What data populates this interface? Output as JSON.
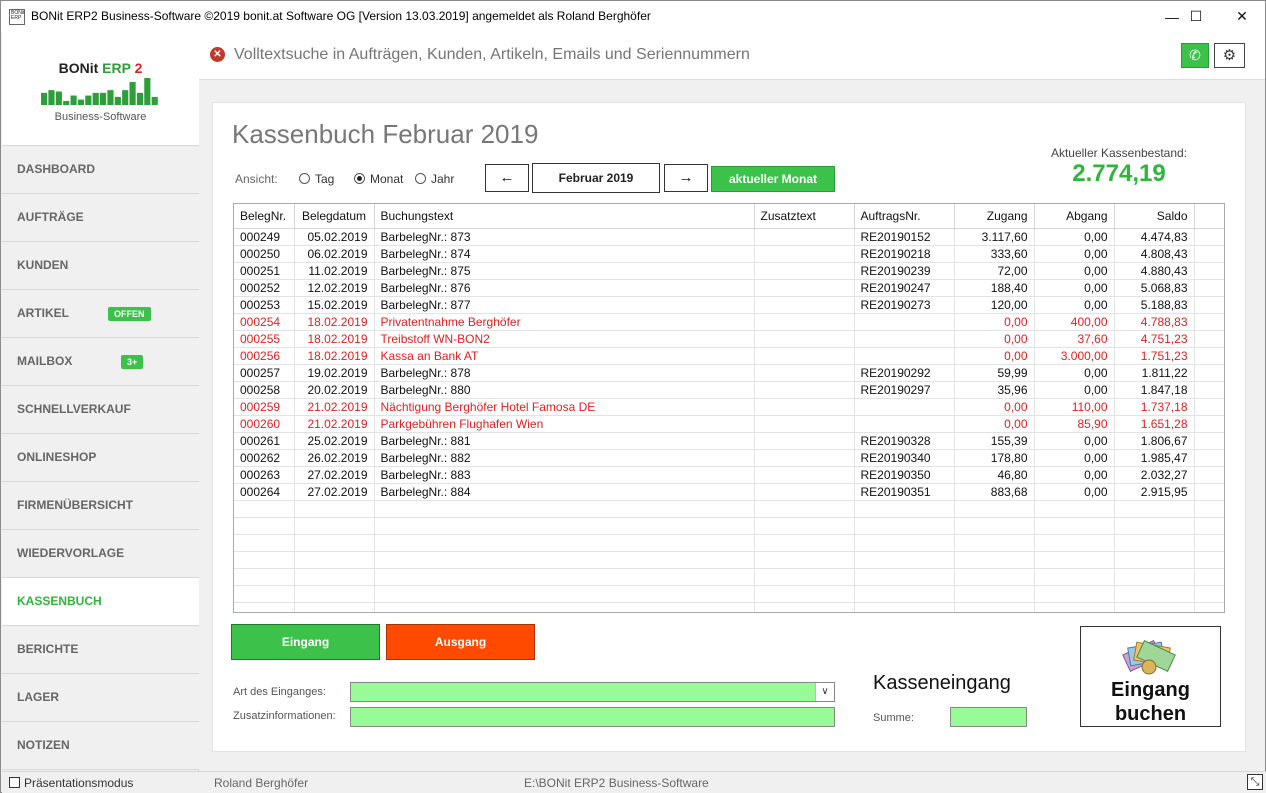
{
  "window": {
    "title": "BONit ERP2 Business-Software ©2019 bonit.at Software OG [Version 13.03.2019] angemeldet als Roland Berghöfer",
    "icon_text": "BONit ERP",
    "minimize": "—",
    "maximize": "☐",
    "close": "✕"
  },
  "logo": {
    "name_a": "BONit ",
    "name_b": "ERP",
    "name_c": " 2",
    "subtitle": "Business-Software",
    "bar_levels": [
      0.45,
      0.55,
      0.5,
      0.15,
      0.35,
      0.2,
      0.35,
      0.45,
      0.45,
      0.55,
      0.3,
      0.55,
      0.85,
      0.45,
      1.0,
      0.3
    ],
    "bar_color": "#2e9e3a"
  },
  "sidebar": {
    "items": [
      {
        "label": "DASHBOARD",
        "badge": ""
      },
      {
        "label": "AUFTRÄGE",
        "badge": ""
      },
      {
        "label": "KUNDEN",
        "badge": ""
      },
      {
        "label": "ARTIKEL",
        "badge": "OFFEN"
      },
      {
        "label": "MAILBOX",
        "badge": "3+"
      },
      {
        "label": "SCHNELLVERKAUF",
        "badge": ""
      },
      {
        "label": "ONLINESHOP",
        "badge": ""
      },
      {
        "label": "FIRMENÜBERSICHT",
        "badge": ""
      },
      {
        "label": "WIEDERVORLAGE",
        "badge": ""
      },
      {
        "label": "KASSENBUCH",
        "badge": "",
        "active": true
      },
      {
        "label": "BERICHTE",
        "badge": ""
      },
      {
        "label": "LAGER",
        "badge": ""
      },
      {
        "label": "NOTIZEN",
        "badge": ""
      }
    ]
  },
  "topbar": {
    "search_placeholder": "Volltextsuche in Aufträgen, Kunden, Artikeln, Emails und Seriennummern",
    "phone_icon": "✆",
    "gear_icon": "⚙"
  },
  "page": {
    "title": "Kassenbuch Februar 2019",
    "balance_label": "Aktueller Kassenbestand:",
    "balance_value": "2.774,19",
    "view_label": "Ansicht:",
    "view_options": [
      "Tag",
      "Monat",
      "Jahr"
    ],
    "view_selected": "Monat",
    "prev": "←",
    "next": "→",
    "month": "Februar 2019",
    "current_month_button": "aktueller Monat"
  },
  "table": {
    "columns": [
      "BelegNr.",
      "Belegdatum",
      "Buchungstext",
      "Zusatztext",
      "AuftragsNr.",
      "Zugang",
      "Abgang",
      "Saldo"
    ],
    "rows": [
      {
        "beleg": "000249",
        "datum": "05.02.2019",
        "text": "BarbelegNr.: 873",
        "zusatz": "",
        "auftrag": "RE20190152",
        "zugang": "3.117,60",
        "abgang": "0,00",
        "saldo": "4.474,83",
        "expense": false
      },
      {
        "beleg": "000250",
        "datum": "06.02.2019",
        "text": "BarbelegNr.: 874",
        "zusatz": "",
        "auftrag": "RE20190218",
        "zugang": "333,60",
        "abgang": "0,00",
        "saldo": "4.808,43",
        "expense": false
      },
      {
        "beleg": "000251",
        "datum": "11.02.2019",
        "text": "BarbelegNr.: 875",
        "zusatz": "",
        "auftrag": "RE20190239",
        "zugang": "72,00",
        "abgang": "0,00",
        "saldo": "4.880,43",
        "expense": false
      },
      {
        "beleg": "000252",
        "datum": "12.02.2019",
        "text": "BarbelegNr.: 876",
        "zusatz": "",
        "auftrag": "RE20190247",
        "zugang": "188,40",
        "abgang": "0,00",
        "saldo": "5.068,83",
        "expense": false
      },
      {
        "beleg": "000253",
        "datum": "15.02.2019",
        "text": "BarbelegNr.: 877",
        "zusatz": "",
        "auftrag": "RE20190273",
        "zugang": "120,00",
        "abgang": "0,00",
        "saldo": "5.188,83",
        "expense": false
      },
      {
        "beleg": "000254",
        "datum": "18.02.2019",
        "text": "Privatentnahme Berghöfer",
        "zusatz": "",
        "auftrag": "",
        "zugang": "0,00",
        "abgang": "400,00",
        "saldo": "4.788,83",
        "expense": true
      },
      {
        "beleg": "000255",
        "datum": "18.02.2019",
        "text": "Treibstoff WN-BON2",
        "zusatz": "",
        "auftrag": "",
        "zugang": "0,00",
        "abgang": "37,60",
        "saldo": "4.751,23",
        "expense": true
      },
      {
        "beleg": "000256",
        "datum": "18.02.2019",
        "text": "Kassa an Bank AT",
        "zusatz": "",
        "auftrag": "",
        "zugang": "0,00",
        "abgang": "3.000,00",
        "saldo": "1.751,23",
        "expense": true
      },
      {
        "beleg": "000257",
        "datum": "19.02.2019",
        "text": "BarbelegNr.: 878",
        "zusatz": "",
        "auftrag": "RE20190292",
        "zugang": "59,99",
        "abgang": "0,00",
        "saldo": "1.811,22",
        "expense": false
      },
      {
        "beleg": "000258",
        "datum": "20.02.2019",
        "text": "BarbelegNr.: 880",
        "zusatz": "",
        "auftrag": "RE20190297",
        "zugang": "35,96",
        "abgang": "0,00",
        "saldo": "1.847,18",
        "expense": false
      },
      {
        "beleg": "000259",
        "datum": "21.02.2019",
        "text": "Nächtigung Berghöfer Hotel Famosa DE",
        "zusatz": "",
        "auftrag": "",
        "zugang": "0,00",
        "abgang": "110,00",
        "saldo": "1.737,18",
        "expense": true
      },
      {
        "beleg": "000260",
        "datum": "21.02.2019",
        "text": "Parkgebühren Flughafen Wien",
        "zusatz": "",
        "auftrag": "",
        "zugang": "0,00",
        "abgang": "85,90",
        "saldo": "1.651,28",
        "expense": true
      },
      {
        "beleg": "000261",
        "datum": "25.02.2019",
        "text": "BarbelegNr.: 881",
        "zusatz": "",
        "auftrag": "RE20190328",
        "zugang": "155,39",
        "abgang": "0,00",
        "saldo": "1.806,67",
        "expense": false
      },
      {
        "beleg": "000262",
        "datum": "26.02.2019",
        "text": "BarbelegNr.: 882",
        "zusatz": "",
        "auftrag": "RE20190340",
        "zugang": "178,80",
        "abgang": "0,00",
        "saldo": "1.985,47",
        "expense": false
      },
      {
        "beleg": "000263",
        "datum": "27.02.2019",
        "text": "BarbelegNr.: 883",
        "zusatz": "",
        "auftrag": "RE20190350",
        "zugang": "46,80",
        "abgang": "0,00",
        "saldo": "2.032,27",
        "expense": false
      },
      {
        "beleg": "000264",
        "datum": "27.02.2019",
        "text": "BarbelegNr.: 884",
        "zusatz": "",
        "auftrag": "RE20190351",
        "zugang": "883,68",
        "abgang": "0,00",
        "saldo": "2.915,95",
        "expense": false
      }
    ],
    "expense_color": "#e02020"
  },
  "form": {
    "in_button": "Eingang",
    "out_button": "Ausgang",
    "in_color": "#3cc24a",
    "out_color": "#ff4a00",
    "type_label": "Art des Einganges:",
    "type_value": "",
    "info_label": "Zusatzinformationen:",
    "info_value": "",
    "section_title": "Kasseneingang",
    "sum_label": "Summe:",
    "sum_value": "",
    "book_button_line1": "Eingang",
    "book_button_line2": "buchen",
    "field_color": "#98fb98"
  },
  "status": {
    "presentation_mode": "Präsentationsmodus",
    "user": "Roland Berghöfer",
    "path": "E:\\BONit ERP2 Business-Software"
  }
}
